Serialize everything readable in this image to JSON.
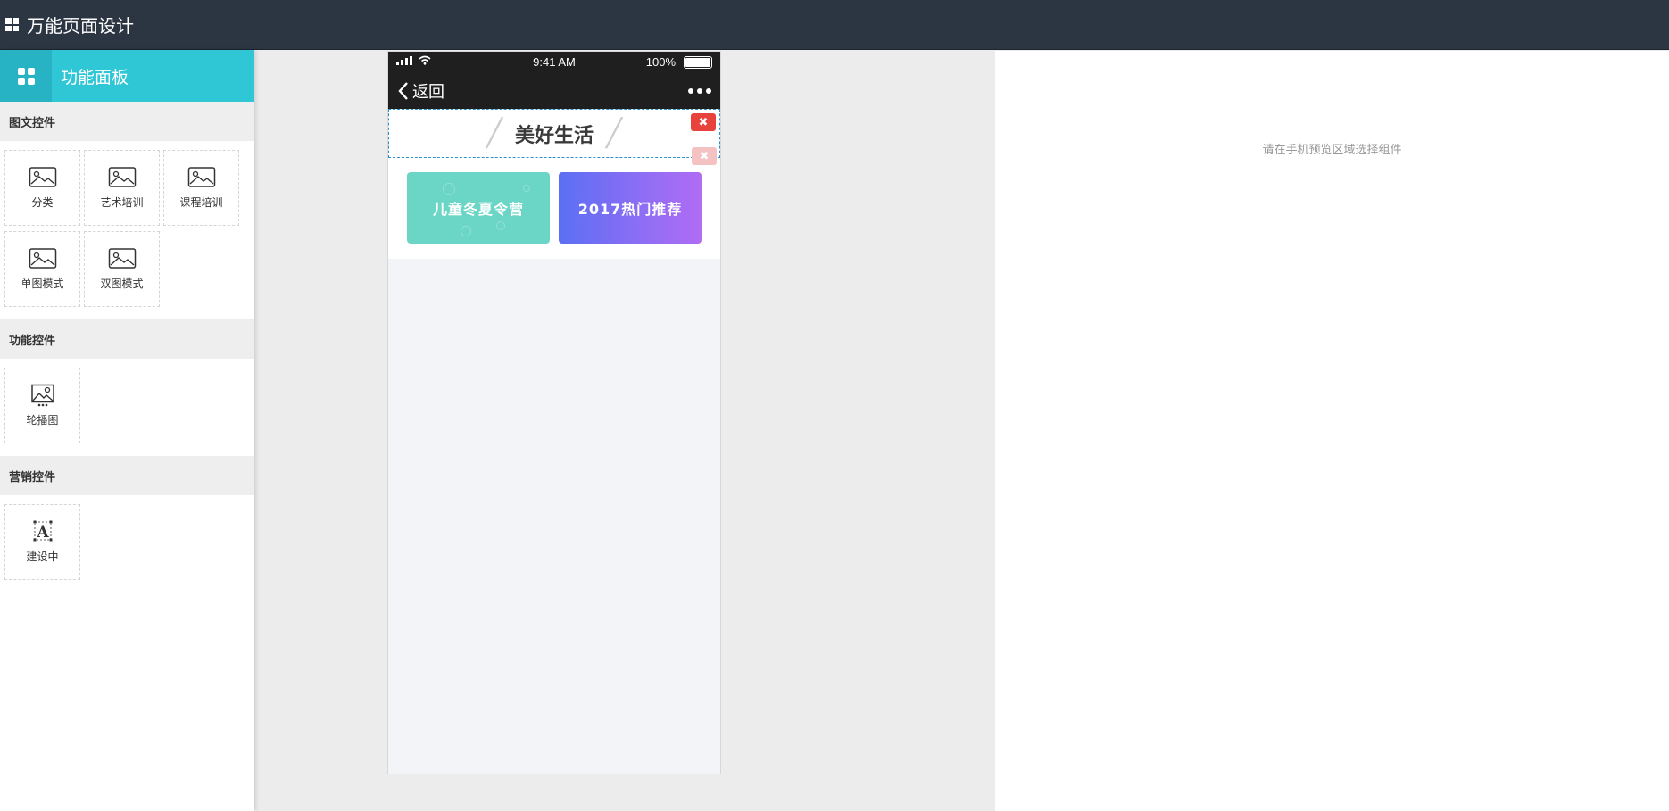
{
  "app": {
    "title": "万能页面设计"
  },
  "panel": {
    "title": "功能面板"
  },
  "sections": [
    {
      "title": "图文控件",
      "items": [
        "分类",
        "艺术培训",
        "课程培训",
        "单图模式",
        "双图模式"
      ]
    },
    {
      "title": "功能控件",
      "items": [
        "轮播图"
      ]
    },
    {
      "title": "营销控件",
      "items": [
        "建设中"
      ]
    }
  ],
  "phone": {
    "status": {
      "time": "9:41 AM",
      "battery": "100%"
    },
    "nav": {
      "back": "返回"
    },
    "title_block": {
      "text": "美好生活"
    },
    "banners": [
      "儿童冬夏令营",
      "2017热门推荐"
    ],
    "delete_glyph": "✖"
  },
  "right": {
    "hint": "请在手机预览区域选择组件"
  },
  "colors": {
    "topbar": "#2c3542",
    "accent": "#2fc6d6",
    "delete": "#e8423c",
    "selection": "#2c8fd0"
  }
}
